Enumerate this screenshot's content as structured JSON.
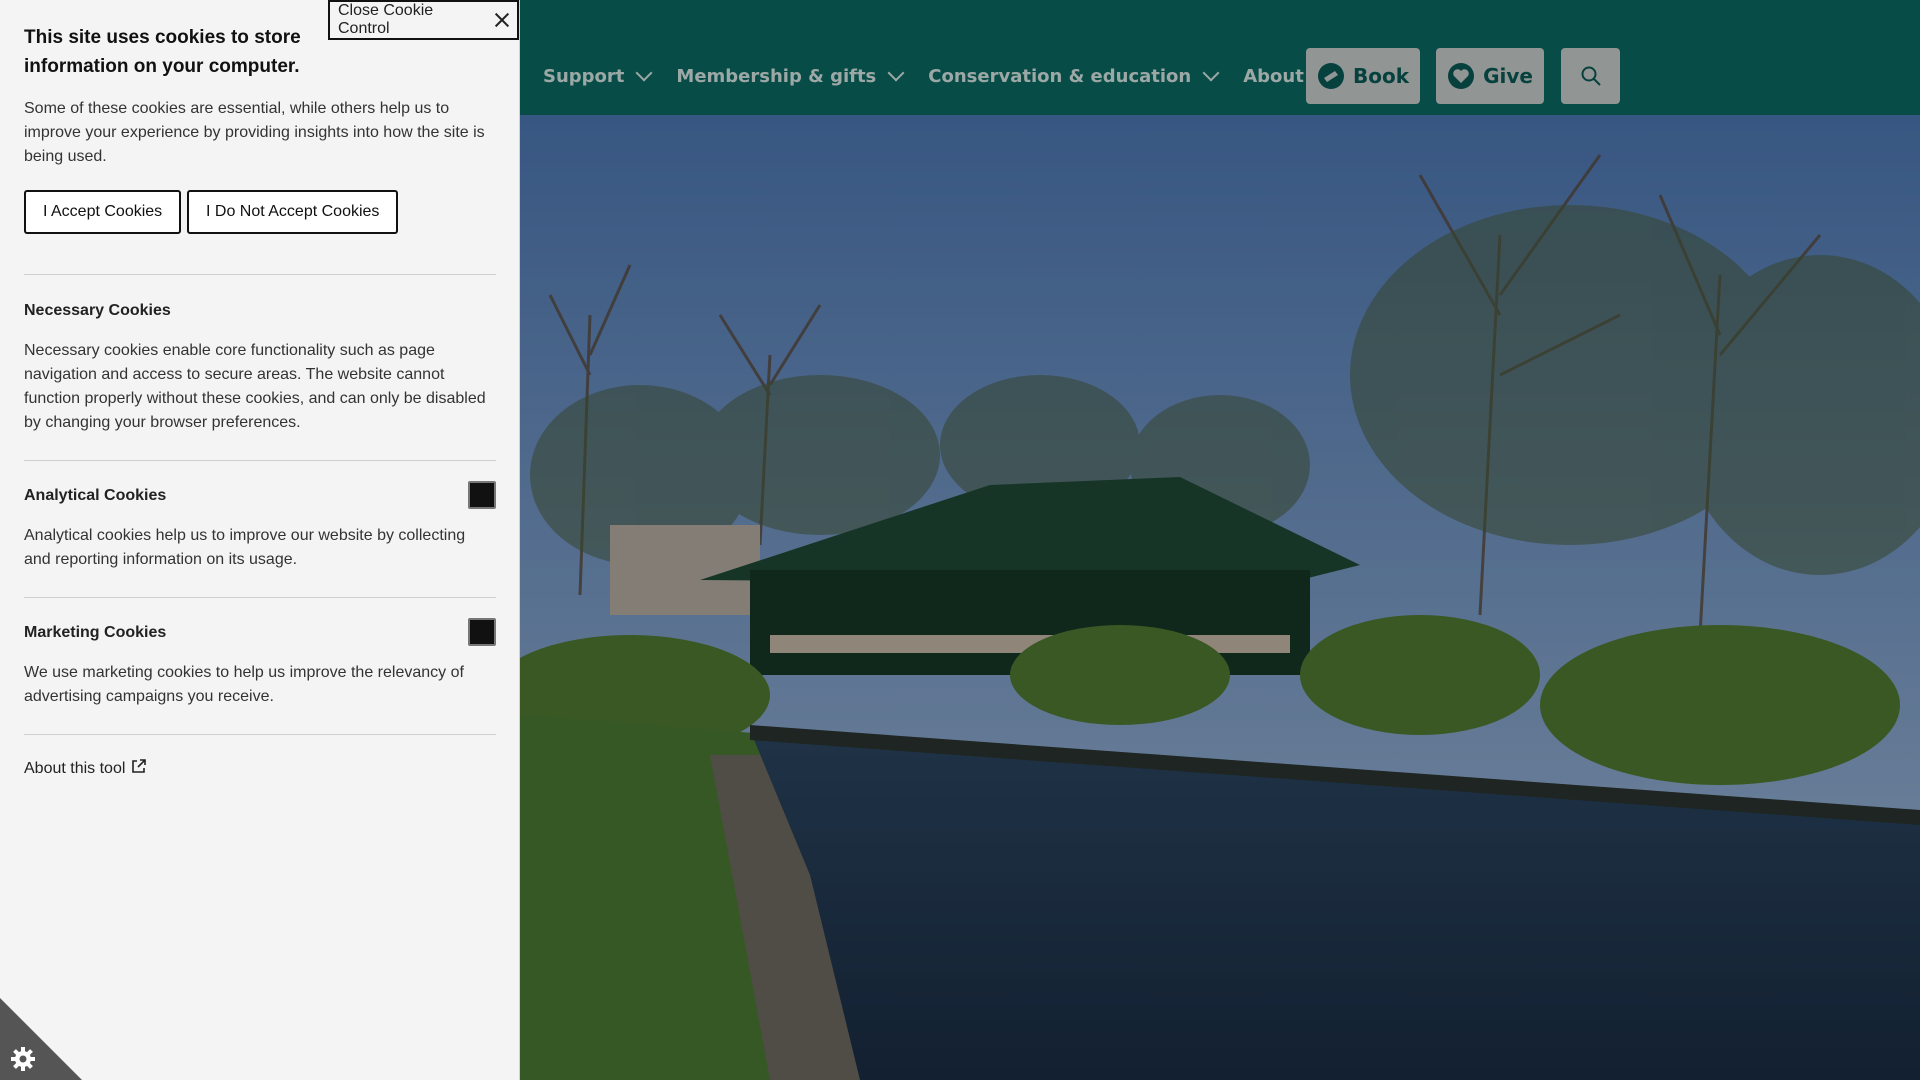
{
  "header": {
    "nav": [
      {
        "label": "Support"
      },
      {
        "label": "Membership & gifts"
      },
      {
        "label": "Conservation & education"
      },
      {
        "label": "About"
      }
    ],
    "book_label": "Book",
    "give_label": "Give"
  },
  "cookie_panel": {
    "close_label": "Close Cookie Control",
    "title": "This site uses cookies to store information on your computer.",
    "intro": "Some of these cookies are essential, while others help us to improve your experience by providing insights into how the site is being used.",
    "accept_label": "I Accept Cookies",
    "reject_label": "I Do Not Accept Cookies",
    "necessary": {
      "title": "Necessary Cookies",
      "text": "Necessary cookies enable core functionality such as page navigation and access to secure areas. The website cannot function properly without these cookies, and can only be disabled by changing your browser preferences."
    },
    "analytical": {
      "title": "Analytical Cookies",
      "text": "Analytical cookies help us to improve our website by collecting and reporting information on its usage."
    },
    "marketing": {
      "title": "Marketing Cookies",
      "text": "We use marketing cookies to help us improve the relevancy of advertising campaigns you receive."
    },
    "about_label": "About this tool"
  },
  "colors": {
    "header_bg": "#0a6a63",
    "panel_bg": "#f4f4f4",
    "button_bg": "#c9cfcd"
  },
  "icons": [
    "chevron-down-icon",
    "ticket-icon",
    "heart-icon",
    "search-icon",
    "close-icon",
    "external-link-icon",
    "cookie-gear-icon"
  ]
}
